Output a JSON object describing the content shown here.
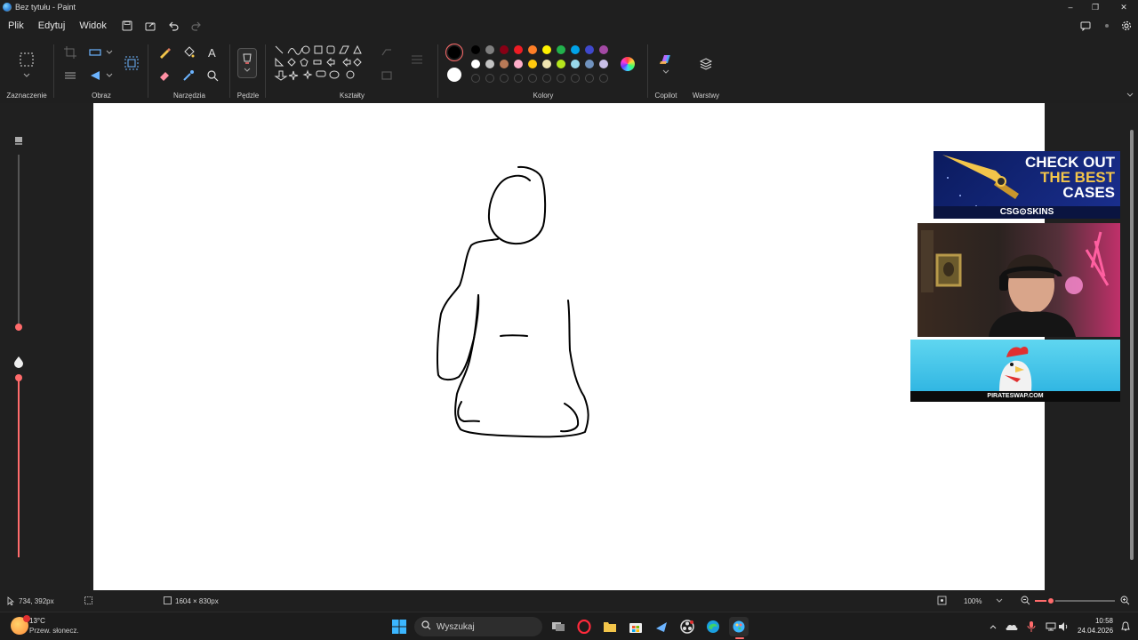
{
  "window": {
    "title": "Bez tytułu - Paint"
  },
  "menu": {
    "items": [
      "Plik",
      "Edytuj",
      "Widok"
    ]
  },
  "ribbon": {
    "groups": {
      "selection": "Zaznaczenie",
      "image": "Obraz",
      "tools": "Narzędzia",
      "brushes": "Pędzle",
      "shapes": "Kształty",
      "colors": "Kolory",
      "copilot": "Copilot",
      "layers": "Warstwy"
    },
    "palette_row1": [
      "#000000",
      "#7f7f7f",
      "#880015",
      "#ed1c24",
      "#ff7f27",
      "#fff200",
      "#22b14c",
      "#00a2e8",
      "#3f48cc",
      "#a349a4"
    ],
    "palette_row2": [
      "#ffffff",
      "#c3c3c3",
      "#b97a57",
      "#ffaec9",
      "#ffc90e",
      "#efe4b0",
      "#b5e61d",
      "#99d9ea",
      "#7092be",
      "#c8bfe7"
    ],
    "primary_color": "#000000",
    "secondary_color": "#ffffff"
  },
  "overlays": {
    "ad_top_line1": "CHECK OUT",
    "ad_top_line2": "THE BEST",
    "ad_top_line3": "CASES",
    "ad_top_brand": "CSG⊙SKINS",
    "ad_bottom_brand": "PIRATESWAP.COM"
  },
  "status": {
    "cursor_position": "734, 392px",
    "canvas_size": "1604 × 830px",
    "zoom": "100%",
    "zoom_level": 0.2
  },
  "taskbar": {
    "weather_temp": "13°C",
    "weather_desc": "Przew. słonecz.",
    "search_placeholder": "Wyszukaj",
    "time": "10:58",
    "date": "24.04.2026"
  },
  "colors": {
    "accent": "#ff6b6b",
    "canvas": "#ffffff",
    "bg": "#1f1f1f"
  }
}
